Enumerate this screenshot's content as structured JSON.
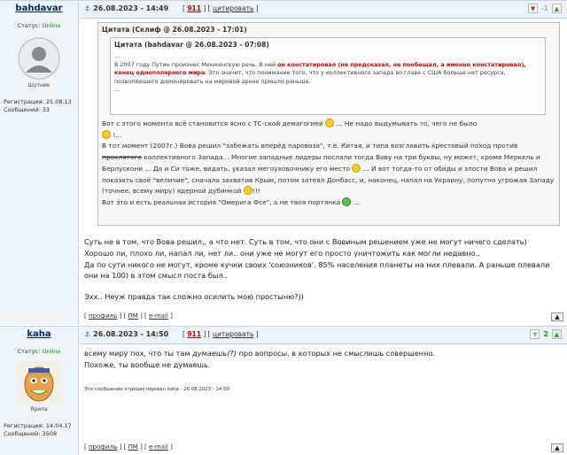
{
  "post1": {
    "username": "bahdavar",
    "status_label": "Статус:",
    "status_value": "Online",
    "rank": "Шутник",
    "reg_label": "Регистрация:",
    "reg_date": "25.08.13",
    "msgs_label": "Сообщений:",
    "msgs_count": "33",
    "datetime": "26.08.2023 - 14:49",
    "post_num": "911",
    "quote_link": "цитировать",
    "rating": "-1",
    "quote_outer_title": "Цитата (Склиф @ 26.08.2023 - 17:01)",
    "quote_inner_title": "Цитата (bahdavar @ 26.08.2023 - 07:08)",
    "inner_dots": "...",
    "inner_p1": "В 2007 году Путин произнес Мюнхенскую речь. В ней ",
    "inner_p1_red": "он констатировал (не предсказал, не пообещал, а именно констатировал), конец однополярного мира",
    "inner_p2": ". Это значит, что понимание того, что у коллективного запада во главе с США больше нет ресурса, позволяющего доминировать на мировой арене пришло раньше.",
    "inner_dots2": "...",
    "outer_line1a": "Вот с этого момента всё становится ясно с ТС-ской демагогией",
    "outer_line1b": "... Не надо выдумывать то, чего не было",
    "outer_line1c": "!...",
    "outer_p2": "В тот момент (2007г.) Вова решил \"забежать вперёд паровоза\", т.е. Китая, и типа возглавить крестовый поход против",
    "outer_strike": "проклятого",
    "outer_p2b": "коллективного Запада... Многие западные лидеры послали тогда Вову на три буквы, ну может, кроме Меркель и Берлускони ... Да и Си тоже, видать, указал мегоуховочнику его место",
    "outer_p2c": "... И вот тогда-то от обиды и злости Вова и решил показать своё \"величие\", сначала захватив Крым, потом затеял Донбасс, и, наконец, напал на Украину, попутно угрожая Западу (точнее, всему миру) ядерной дубинкой",
    "outer_p2d": "!!!",
    "outer_p3": "Вот это и есть реальная история \"Омерига Фсе\", а не твоя портянка",
    "outer_p3b": "...",
    "reply1": "Суть не в том, что Вова решил,, а что нет. Суть в том, что они с Вовиным решением уже не могут ничего сделать)",
    "reply2": "Хорошо ли, плохо ли, напал ли, нет ли.. они уже не могут его просто уничтожить как могли недавно..",
    "reply3": "Да по сути никого не могут, кроме кучки своих 'союзников'. 85% населения планеты на них плевали. А раньше плевали они на 100) в этом смысл поста был..",
    "reply4": "Эхх.. Неуж правда так сложно осилить мою простыню?))",
    "footer_profile": "профиль",
    "footer_pm": "ПМ",
    "footer_email": "e-mail"
  },
  "post2": {
    "username": "kaha",
    "status_label": "Статус:",
    "status_value": "Online",
    "rank": "Ярила",
    "reg_label": "Регистрация:",
    "reg_date": "14.04.17",
    "msgs_label": "Сообщений:",
    "msgs_count": "3508",
    "datetime": "26.08.2023 - 14:50",
    "post_num": "911",
    "quote_link": "цитировать",
    "rating": "2",
    "line1a": "всему миру пох, что ты там",
    "line1b": "думаешь(?)",
    "line1c": "про вопросы, в которых не смыслишь совершенно.",
    "line2": "Похоже, ты вообще не думаешь.",
    "edited": "Это сообщение отредактировал kaha - 26.08.2023 - 14:50",
    "footer_profile": "профиль",
    "footer_pm": "ПМ",
    "footer_email": "e-mail"
  },
  "colors": {
    "header_bg": "#eef3f8",
    "online": "#0a9a0a",
    "red": "#cc0000",
    "link": "#002a66"
  }
}
